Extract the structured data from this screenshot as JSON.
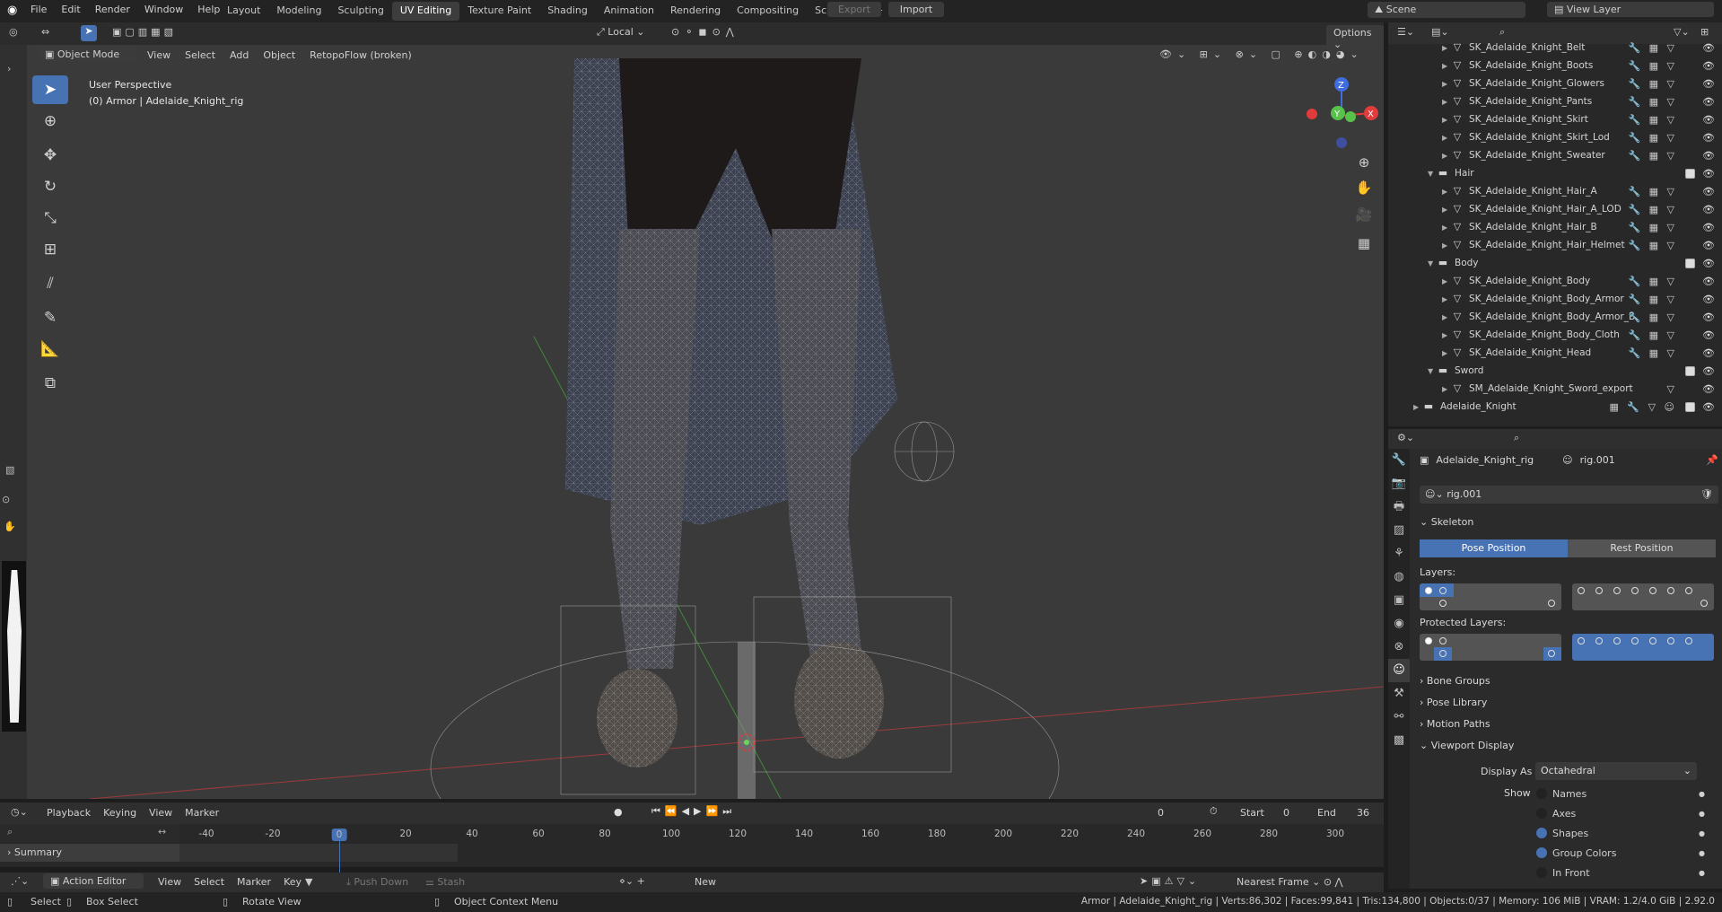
{
  "topbar": {
    "menus": [
      "File",
      "Edit",
      "Render",
      "Window",
      "Help"
    ],
    "workspaces": [
      "Layout",
      "Modeling",
      "Sculpting",
      "UV Editing",
      "Texture Paint",
      "Shading",
      "Animation",
      "Rendering",
      "Compositing",
      "Scripting"
    ],
    "active_workspace": "UV Editing",
    "add_tab": "+",
    "export": "Export",
    "import": "Import",
    "scene": "Scene",
    "view_layer": "View Layer"
  },
  "viewport": {
    "options": "Options",
    "mode": "Object Mode",
    "menus": [
      "View",
      "Select",
      "Add",
      "Object"
    ],
    "addon": "RetopoFlow (broken)",
    "orientation": "Local",
    "perspective": "User Perspective",
    "context": "(0) Armor | Adelaide_Knight_rig",
    "gizmo": {
      "z": "Z",
      "y": "Y",
      "x": "X"
    }
  },
  "outliner": {
    "rows": [
      {
        "type": "mesh",
        "label": "SK_Adelaide_Knight_Belt",
        "indent": 2,
        "mods": "🔧 ▦ ▽"
      },
      {
        "type": "mesh",
        "label": "SK_Adelaide_Knight_Boots",
        "indent": 2,
        "mods": "🔧 ▦ ▽"
      },
      {
        "type": "mesh",
        "label": "SK_Adelaide_Knight_Glowers",
        "indent": 2,
        "mods": "🔧 ▦ ▽"
      },
      {
        "type": "mesh",
        "label": "SK_Adelaide_Knight_Pants",
        "indent": 2,
        "mods": "🔧 ▦ ▽"
      },
      {
        "type": "mesh",
        "label": "SK_Adelaide_Knight_Skirt",
        "indent": 2,
        "mods": "🔧 ▦ ▽"
      },
      {
        "type": "mesh",
        "label": "SK_Adelaide_Knight_Skirt_Lod",
        "indent": 2,
        "mods": "🔧 ▦ ▽"
      },
      {
        "type": "mesh",
        "label": "SK_Adelaide_Knight_Sweater",
        "indent": 2,
        "mods": "🔧 ▦ ▽"
      },
      {
        "type": "collection",
        "label": "Hair",
        "indent": 1
      },
      {
        "type": "mesh",
        "label": "SK_Adelaide_Knight_Hair_A",
        "indent": 2,
        "mods": "🔧 ▦ ▽"
      },
      {
        "type": "mesh",
        "label": "SK_Adelaide_Knight_Hair_A_LOD",
        "indent": 2,
        "mods": "🔧 ▦ ▽"
      },
      {
        "type": "mesh",
        "label": "SK_Adelaide_Knight_Hair_B",
        "indent": 2,
        "mods": "🔧 ▦ ▽"
      },
      {
        "type": "mesh",
        "label": "SK_Adelaide_Knight_Hair_Helmet",
        "indent": 2,
        "mods": "🔧 ▦ ▽"
      },
      {
        "type": "collection",
        "label": "Body",
        "indent": 1
      },
      {
        "type": "mesh",
        "label": "SK_Adelaide_Knight_Body",
        "indent": 2,
        "mods": "🔧 ▦ ▽"
      },
      {
        "type": "mesh",
        "label": "SK_Adelaide_Knight_Body_Armor",
        "indent": 2,
        "mods": "🔧 ▦ ▽"
      },
      {
        "type": "mesh",
        "label": "SK_Adelaide_Knight_Body_Armor_B",
        "indent": 2,
        "mods": "🔧 ▦ ▽"
      },
      {
        "type": "mesh",
        "label": "SK_Adelaide_Knight_Body_Cloth",
        "indent": 2,
        "mods": "🔧 ▦ ▽"
      },
      {
        "type": "mesh",
        "label": "SK_Adelaide_Knight_Head",
        "indent": 2,
        "mods": "🔧 ▦ ▽"
      },
      {
        "type": "collection",
        "label": "Sword",
        "indent": 1
      },
      {
        "type": "mesh",
        "label": "SM_Adelaide_Knight_Sword_export",
        "indent": 2,
        "mods": "▽"
      },
      {
        "type": "collection",
        "label": "Adelaide_Knight",
        "indent": 0,
        "mods": "▦ 🔧 ▽ ☺"
      }
    ]
  },
  "properties": {
    "object": "Adelaide_Knight_rig",
    "data": "rig.001",
    "datablock": "rig.001",
    "skeleton": "Skeleton",
    "pose_position": "Pose Position",
    "rest_position": "Rest Position",
    "layers": "Layers:",
    "protected_layers": "Protected Layers:",
    "collapsed": [
      "Bone Groups",
      "Pose Library",
      "Motion Paths"
    ],
    "viewport_display": "Viewport Display",
    "display_as_label": "Display As",
    "display_as": "Octahedral",
    "show_label": "Show",
    "show": [
      {
        "label": "Names",
        "on": false
      },
      {
        "label": "Axes",
        "on": false
      },
      {
        "label": "Shapes",
        "on": true
      },
      {
        "label": "Group Colors",
        "on": true
      },
      {
        "label": "In Front",
        "on": false
      }
    ]
  },
  "timeline": {
    "menus": [
      "Playback",
      "Keying",
      "View",
      "Marker"
    ],
    "current_frame": "0",
    "start_label": "Start",
    "start": "0",
    "end_label": "End",
    "end": "36",
    "ruler": [
      "-40",
      "-20",
      "0",
      "20",
      "40",
      "60",
      "80",
      "100",
      "120",
      "140",
      "160",
      "180",
      "200",
      "220",
      "240",
      "260",
      "280",
      "300"
    ],
    "summary": "Summary"
  },
  "action_editor": {
    "mode": "Action Editor",
    "menus": [
      "View",
      "Select",
      "Marker",
      "Key"
    ],
    "push_down": "Push Down",
    "stash": "Stash",
    "new": "New",
    "snap": "Nearest Frame"
  },
  "statusbar": {
    "select": "Select",
    "box_select": "Box Select",
    "rotate_view": "Rotate View",
    "context_menu": "Object Context Menu",
    "stats": "Armor | Adelaide_Knight_rig | Verts:86,302 | Faces:99,841 | Tris:134,800 | Objects:0/37 | Memory: 106 MiB | VRAM: 1.2/4.0 GiB | 2.92.0"
  },
  "colors": {
    "accent": "#4772b3",
    "x_axis": "#e23b3b",
    "y_axis": "#57c24a",
    "z_axis": "#3f6ce0"
  }
}
